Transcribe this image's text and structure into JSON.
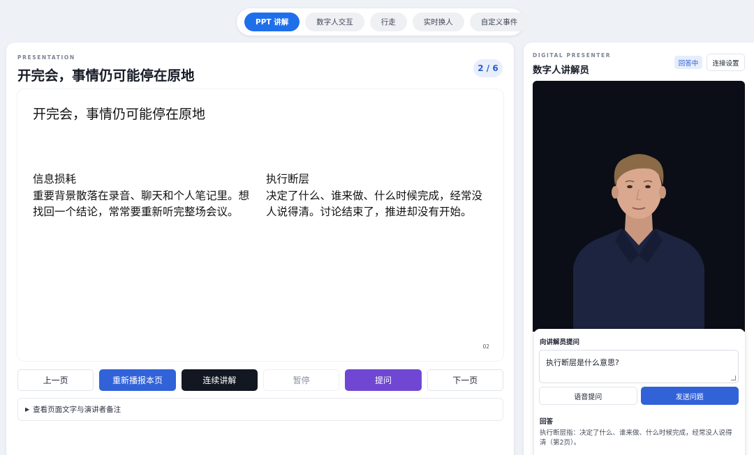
{
  "top_tabs": [
    {
      "label": "PPT 讲解",
      "active": true
    },
    {
      "label": "数字人交互",
      "active": false
    },
    {
      "label": "行走",
      "active": false
    },
    {
      "label": "实时换人",
      "active": false
    },
    {
      "label": "自定义事件",
      "active": false
    }
  ],
  "presentation": {
    "eyebrow": "PRESENTATION",
    "title": "开完会，事情仍可能停在原地",
    "page_counter": "2 / 6",
    "slide": {
      "title": "开完会，事情仍可能停在原地",
      "col1_heading": "信息损耗",
      "col1_body": "重要背景散落在录音、聊天和个人笔记里。想找回一个结论，常常要重新听完整场会议。",
      "col2_heading": "执行断层",
      "col2_body": "决定了什么、谁来做、什么时候完成，经常没人说得清。讨论结束了，推进却没有开始。",
      "page_number": "02"
    },
    "controls": {
      "prev": "上一页",
      "replay": "重新播报本页",
      "continuous": "连续讲解",
      "pause": "暂停",
      "ask": "提问",
      "next": "下一页"
    },
    "notes_toggle": "查看页面文字与演讲者备注"
  },
  "presenter": {
    "eyebrow": "DIGITAL PRESENTER",
    "title": "数字人讲解员",
    "status": "回答中",
    "connection_settings": "连接设置",
    "ask_card": {
      "label": "向讲解员提问",
      "input_value": "执行断层是什么意思?",
      "voice_button": "语音提问",
      "send_button": "发送问题",
      "answer_label": "回答",
      "answer_text": "执行断层指：决定了什么、谁来做、什么时候完成，经常没人说得清（第2页）。"
    }
  },
  "colors": {
    "accent_blue": "#1f6feb",
    "button_blue": "#3162d8",
    "button_dark": "#121722",
    "button_purple": "#7047d2",
    "video_bg": "#0b0e16"
  }
}
